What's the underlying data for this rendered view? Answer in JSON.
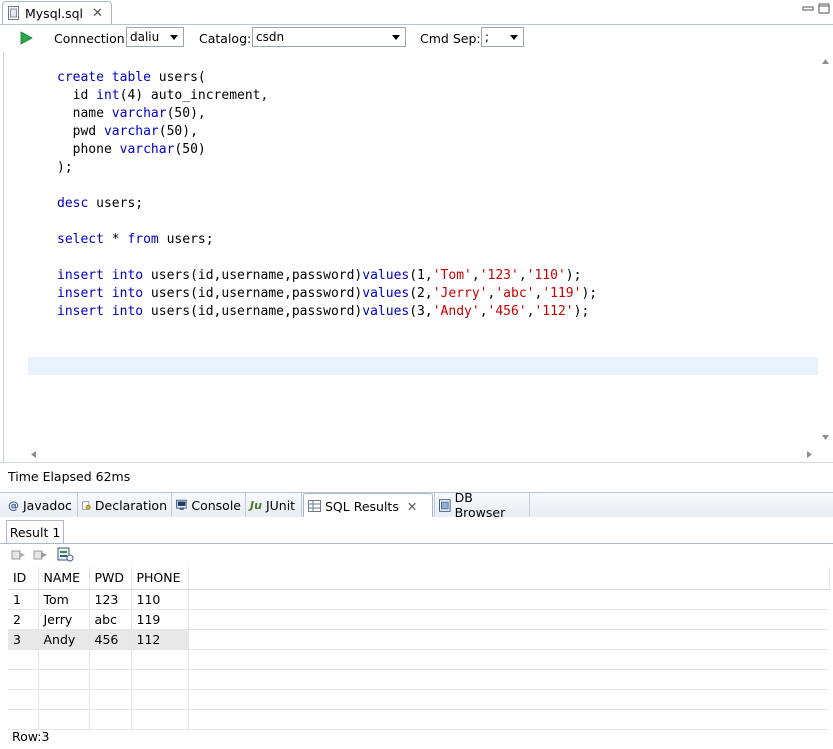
{
  "editor_tab": {
    "title": "Mysql.sql",
    "close": "✕"
  },
  "toolbar": {
    "run_icon": "run-icon",
    "connection_label": "Connection:",
    "connection_value": "daliu",
    "catalog_label": "Catalog:",
    "catalog_value": "csdn",
    "cmdsep_label": "Cmd Sep:",
    "cmdsep_value": ";"
  },
  "code_lines": [
    "create table users(",
    "  id int(4) auto_increment,",
    "  name varchar(50),",
    "  pwd varchar(50),",
    "  phone varchar(50)",
    ");",
    "",
    "desc users;",
    "",
    "select * from users;",
    "",
    "insert into users(id,username,password)values(1,'Tom','123','110');",
    "insert into users(id,username,password)values(2,'Jerry','abc','119');",
    "insert into users(id,username,password)values(3,'Andy','456','112');"
  ],
  "status": {
    "text": "Time Elapsed 62ms"
  },
  "views": {
    "tabs": [
      {
        "label": "Javadoc",
        "icon": "@"
      },
      {
        "label": "Declaration",
        "icon": "declaration-icon"
      },
      {
        "label": "Console",
        "icon": "console-icon"
      },
      {
        "label": "JUnit",
        "icon": "Ju"
      },
      {
        "label": "SQL Results",
        "icon": "sql-results-icon",
        "active": true,
        "close": "✕"
      },
      {
        "label": "DB Browser",
        "icon": "db-browser-icon"
      }
    ]
  },
  "results": {
    "tab_label": "Result 1",
    "columns": [
      "ID",
      "NAME",
      "PWD",
      "PHONE"
    ],
    "rows": [
      [
        "1",
        "Tom",
        "123",
        "110"
      ],
      [
        "2",
        "Jerry",
        "abc",
        "119"
      ],
      [
        "3",
        "Andy",
        "456",
        "112"
      ]
    ],
    "selected_row": 3,
    "row_count_text": "Row:3"
  },
  "colors": {
    "keyword": "#0000c8",
    "string": "#c80000",
    "current_line": "#e8f2fe"
  }
}
